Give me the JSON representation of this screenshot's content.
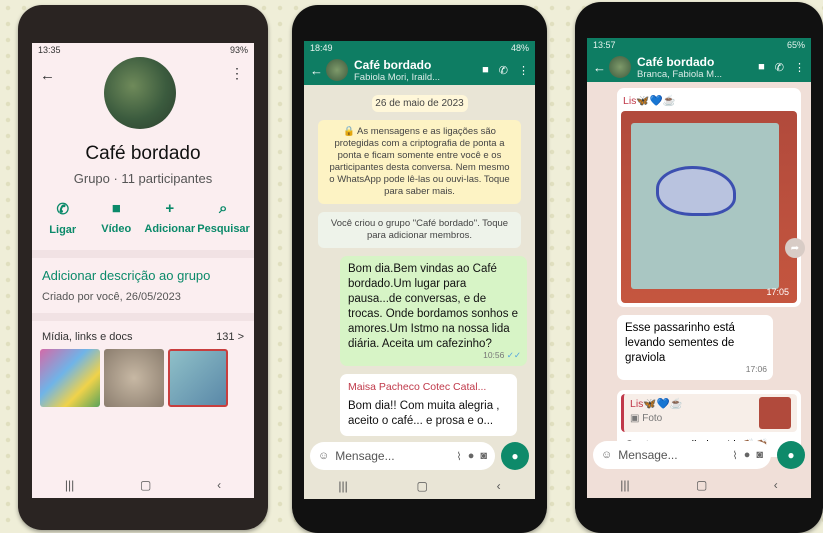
{
  "phone1": {
    "status_time": "13:35",
    "status_battery": "93%",
    "group_name": "Café bordado",
    "group_subtitle": "Grupo · 11 participantes",
    "actions": [
      {
        "label": "Ligar",
        "icon": "phone-icon"
      },
      {
        "label": "Vídeo",
        "icon": "video-icon"
      },
      {
        "label": "Adicionar",
        "icon": "add-person-icon"
      },
      {
        "label": "Pesquisar",
        "icon": "search-icon"
      }
    ],
    "add_description": "Adicionar descrição ao grupo",
    "created_by": "Criado por você, 26/05/2023",
    "media_label": "Mídia, links e docs",
    "media_count": "131 >"
  },
  "phone2": {
    "status_time": "18:49",
    "status_battery": "48%",
    "chat_name": "Café bordado",
    "chat_members": "Fabiola Mori, Iraild...",
    "date_chip": "26 de maio de 2023",
    "encryption_note": "As mensagens e as ligações são protegidas com a criptografia de ponta a ponta e ficam somente entre você e os participantes desta conversa. Nem mesmo o WhatsApp pode lê-las ou ouvi-las. Toque para saber mais.",
    "created_note": "Você criou o grupo \"Café bordado\". Toque para adicionar membros.",
    "welcome_message": "Bom dia.Bem vindas ao  Café bordado.Um lugar para pausa...de conversas, e de trocas. Onde bordamos sonhos e amores.Um Istmo na nossa lida diária. Aceita um cafezinho?",
    "welcome_time": "10:56",
    "incoming_sender": "Maisa Pacheco Cotec Catal...",
    "incoming_message": "Bom dia!! Com muita alegria , aceito o café... e prosa e o...",
    "composer_placeholder": "Mensage..."
  },
  "phone3": {
    "status_time": "13:57",
    "status_battery": "65%",
    "chat_name": "Café bordado",
    "chat_members": "Branca, Fabiola M...",
    "image_sender": "Lis🦋💙☕",
    "image_time": "17:05",
    "caption": "Esse passarinho está levando sementes de graviola",
    "caption_time": "17:06",
    "reply_quote_sender": "Lis🦋💙☕",
    "reply_quote_type": "Foto",
    "reply_text": "Gente ....que lindo... Lis👏🏽👏🏽",
    "composer_placeholder": "Mensage..."
  }
}
